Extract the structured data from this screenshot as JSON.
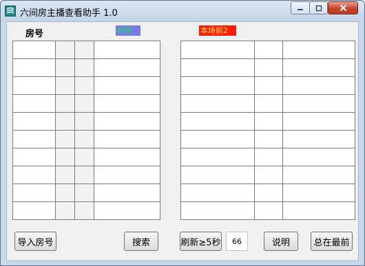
{
  "window": {
    "title": "六间房主播查看助手 1.0",
    "icon": "app-icon"
  },
  "labels": {
    "room": "房号",
    "left_tag": "新開",
    "right_tag": "本场前2"
  },
  "left_table": {
    "rows": 10,
    "cols": 4
  },
  "right_table": {
    "rows": 10,
    "cols": 3
  },
  "buttons": {
    "import": "导入房号",
    "search": "搜索",
    "refresh": "刷新≥5秒",
    "help": "说明",
    "topmost": "总在最前"
  },
  "refresh_input": {
    "value": "66"
  },
  "colors": {
    "left_tag_bg": "#7b79e8",
    "right_tag_bg": "#ff1a00"
  }
}
